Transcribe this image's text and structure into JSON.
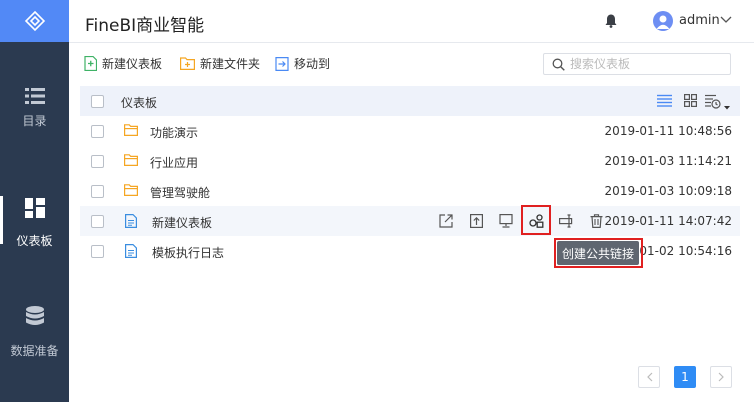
{
  "app": {
    "title": "FineBI商业智能"
  },
  "user": {
    "name": "admin"
  },
  "sidebar": {
    "items": [
      {
        "label": "目录",
        "icon": "list-icon"
      },
      {
        "label": "仪表板",
        "icon": "dashboard-grid-icon",
        "active": true
      },
      {
        "label": "数据准备",
        "icon": "database-icon"
      }
    ]
  },
  "toolbar": {
    "new_dashboard": "新建仪表板",
    "new_folder": "新建文件夹",
    "move_to": "移动到",
    "search_placeholder": "搜索仪表板"
  },
  "table": {
    "header": "仪表板",
    "rows": [
      {
        "type": "folder",
        "name": "功能演示",
        "time": "2019-01-11 10:48:56"
      },
      {
        "type": "folder",
        "name": "行业应用",
        "time": "2019-01-03 11:14:21"
      },
      {
        "type": "folder",
        "name": "管理驾驶舱",
        "time": "2019-01-03 10:09:18"
      },
      {
        "type": "dashboard",
        "name": "新建仪表板",
        "time": "2019-01-11 14:07:42"
      },
      {
        "type": "dashboard",
        "name": "模板执行日志",
        "time": "2019-01-02 10:54:16"
      }
    ]
  },
  "tooltip": "创建公共链接",
  "pagination": {
    "current": "1"
  },
  "colors": {
    "accent": "#5289f6",
    "sidebar": "#2b3a50",
    "highlight": "#e02020",
    "folder": "#f5a623"
  }
}
